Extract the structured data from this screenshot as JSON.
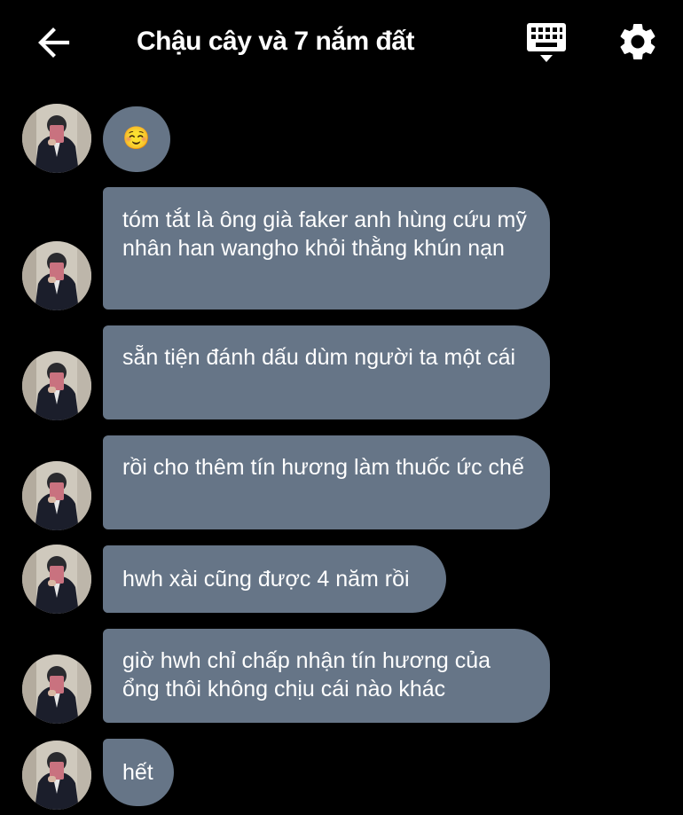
{
  "header": {
    "title": "Chậu cây và 7 nắm đất",
    "back_icon": "arrow-left-icon",
    "keyboard_icon": "keyboard-icon",
    "settings_icon": "gear-icon"
  },
  "colors": {
    "background": "#000000",
    "bubble": "#667587",
    "text": "#ffffff"
  },
  "messages": [
    {
      "text": "☺️"
    },
    {
      "text": "tóm tắt là ông già faker anh hùng cứu mỹ nhân han wangho khỏi thằng khún nạn"
    },
    {
      "text": "sẵn tiện đánh dấu dùm người ta một cái"
    },
    {
      "text": "rồi cho thêm tín hương làm thuốc ức chế"
    },
    {
      "text": "hwh xài cũng được 4 năm rồi"
    },
    {
      "text": "giờ hwh chỉ chấp nhận tín hương của ổng thôi không chịu cái nào khác"
    },
    {
      "text": "hết"
    }
  ]
}
